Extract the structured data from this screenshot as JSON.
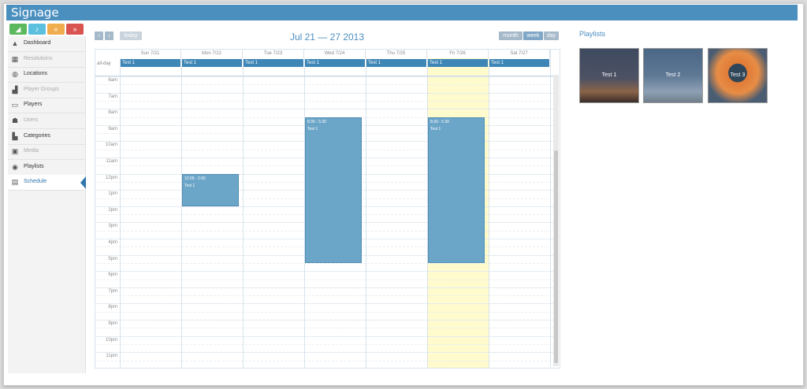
{
  "app": {
    "title": "Signage"
  },
  "quick_actions": [
    {
      "icon": "signal-icon",
      "glyph": "◢",
      "color": "#5cb85c"
    },
    {
      "icon": "bell-icon",
      "glyph": "♪",
      "color": "#5bc0de"
    },
    {
      "icon": "forward-icon",
      "glyph": "«",
      "color": "#f0ad4e"
    },
    {
      "icon": "stop-icon",
      "glyph": "»",
      "color": "#d9534f"
    }
  ],
  "sidebar": {
    "items": [
      {
        "label": "Dashboard",
        "icon": "dashboard-icon",
        "glyph": "▲",
        "state": "normal"
      },
      {
        "label": "Resolutions",
        "icon": "grid-icon",
        "glyph": "▦",
        "state": "dim"
      },
      {
        "label": "Locations",
        "icon": "globe-icon",
        "glyph": "◍",
        "state": "normal"
      },
      {
        "label": "Player Groups",
        "icon": "group-icon",
        "glyph": "▟",
        "state": "dim"
      },
      {
        "label": "Players",
        "icon": "monitor-icon",
        "glyph": "▭",
        "state": "normal"
      },
      {
        "label": "Users",
        "icon": "users-icon",
        "glyph": "☗",
        "state": "dim"
      },
      {
        "label": "Categories",
        "icon": "chart-icon",
        "glyph": "▙",
        "state": "normal"
      },
      {
        "label": "Media",
        "icon": "picture-icon",
        "glyph": "▣",
        "state": "dim"
      },
      {
        "label": "Playlists",
        "icon": "playlist-icon",
        "glyph": "◉",
        "state": "normal"
      },
      {
        "label": "Schedule",
        "icon": "calendar-icon",
        "glyph": "▤",
        "state": "active"
      }
    ]
  },
  "calendar": {
    "nav": {
      "prev": "‹",
      "next": "›",
      "today": "today"
    },
    "range_title": "Jul 21 — 27 2013",
    "views": [
      "month",
      "week",
      "day"
    ],
    "active_view": "week",
    "allday_label": "all-day",
    "days": [
      "Sun 7/21",
      "Mon 7/22",
      "Tue 7/23",
      "Wed 7/24",
      "Thu 7/25",
      "Fri 7/26",
      "Sat 7/27"
    ],
    "today_index": 5,
    "allday_events": [
      "Test 1",
      "Test 1",
      "Test 1",
      "Test 1",
      "Test 1",
      "Test 1",
      "Test 1"
    ],
    "hours": [
      "6am",
      "7am",
      "8am",
      "9am",
      "10am",
      "11am",
      "12pm",
      "1pm",
      "2pm",
      "3pm",
      "4pm",
      "5pm",
      "6pm",
      "7pm",
      "8pm",
      "9pm",
      "10pm",
      "11pm"
    ],
    "timed_events": [
      {
        "day": 1,
        "start": 12,
        "end": 14,
        "time": "12:00 - 2:00",
        "title": "Test 1"
      },
      {
        "day": 3,
        "start": 8.5,
        "end": 17.5,
        "time": "8:30 - 5:30",
        "title": "Test 1"
      },
      {
        "day": 5,
        "start": 8.5,
        "end": 17.5,
        "time": "8:30 - 5:30",
        "title": "Test 1"
      }
    ]
  },
  "playlists": {
    "title": "Playlists",
    "items": [
      {
        "label": "Test 1",
        "bg": "linear-gradient(#3e4a5f 0%, #4d5164 55%, #8a6448 80%, #3a2d28 100%)"
      },
      {
        "label": "Test 2",
        "bg": "linear-gradient(#4b6786 0%, #5e7894 50%, #8ea0b4 80%, #6e7d8a 100%)"
      },
      {
        "label": "Test 3",
        "bg": "radial-gradient(circle at 50% 45%, #2f4659 0%, #2f4659 22%, #e07b36 23%, #e78d46 50%, #4b5d72 75%)"
      }
    ]
  }
}
